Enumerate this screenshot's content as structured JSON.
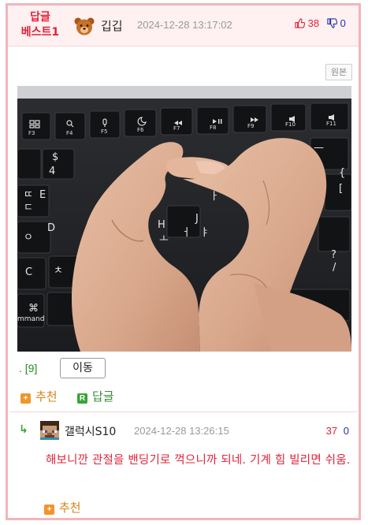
{
  "header": {
    "best_badge_line1": "답글",
    "best_badge_line2": "베스트1",
    "author": "깁깁",
    "date": "2024-12-28 13:17:02",
    "upvotes": "38",
    "downvotes": "0"
  },
  "original_button": "원본",
  "post": {
    "link_text": ". [9]",
    "move_button": "이동",
    "recommend_label": "추천",
    "reply_label": "답글",
    "recommend_icon": "+",
    "reply_icon": "R"
  },
  "comment": {
    "author": "갤럭시S10",
    "date": "2024-12-28 13:26:15",
    "upvotes": "37",
    "downvotes": "0",
    "text": "해보니깐 관절을 밴딩기로 꺽으니까 되네. 기계 힘 빌리면 쉬움.",
    "recommend_label": "추천",
    "recommend_icon": "+",
    "reply_marker": "↳"
  },
  "keyboard_keys": [
    {
      "label": "F3",
      "icon": "grid-icon"
    },
    {
      "label": "F4",
      "icon": "search-icon"
    },
    {
      "label": "F5",
      "icon": "mic-icon"
    },
    {
      "label": "F6",
      "icon": "moon-icon"
    },
    {
      "label": "F7",
      "icon": "rewind-icon"
    },
    {
      "label": "F8",
      "icon": "play-pause-icon"
    },
    {
      "label": "F9",
      "icon": "fast-forward-icon"
    },
    {
      "label": "F10",
      "icon": "volume-mute-icon"
    },
    {
      "label": "F11",
      "icon": "volume-down-icon"
    }
  ],
  "keyboard_text": [
    "$",
    "4",
    "ㄸ",
    "ㄷ",
    "E",
    "D",
    "ㅇ",
    "C",
    "ㅊ",
    "⌘",
    "mmand",
    "H",
    "ㅗ",
    "J",
    "ㅓ",
    "ㅑ",
    "ㅏ",
    "?",
    "/",
    "{",
    "[",
    "—",
    "-"
  ],
  "colors": {
    "border": "#f2b5bb",
    "header_bg": "#fff0f1",
    "accent_red": "#e0233a",
    "vote_blue": "#2233aa",
    "recommend_orange": "#f0952a",
    "reply_green": "#3aa33a"
  }
}
